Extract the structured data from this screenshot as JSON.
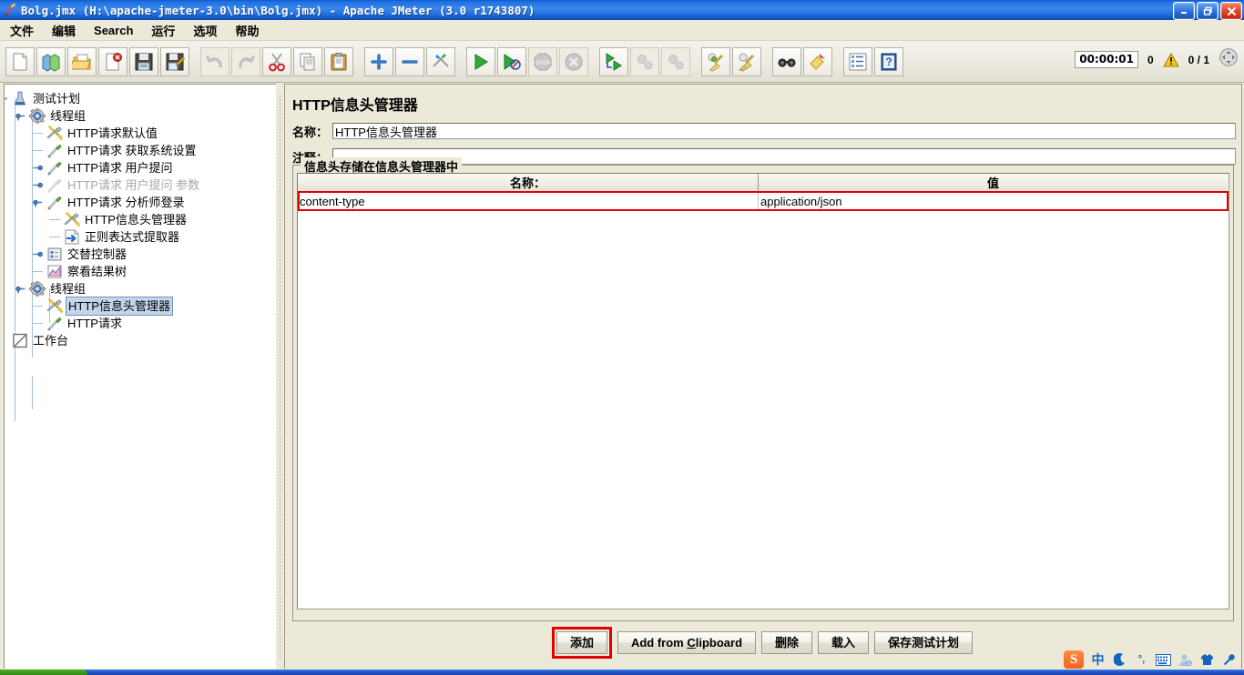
{
  "window": {
    "title": "Bolg.jmx (H:\\apache-jmeter-3.0\\bin\\Bolg.jmx) - Apache JMeter (3.0 r1743807)",
    "icon": "jmeter-feather-icon",
    "minimize_label": "_",
    "maximize_label": "❐",
    "close_label": "✕"
  },
  "menubar": {
    "items": [
      {
        "label": "文件",
        "name": "menu-file"
      },
      {
        "label": "编辑",
        "name": "menu-edit"
      },
      {
        "label": "Search",
        "name": "menu-search"
      },
      {
        "label": "运行",
        "name": "menu-run"
      },
      {
        "label": "选项",
        "name": "menu-options"
      },
      {
        "label": "帮助",
        "name": "menu-help"
      }
    ]
  },
  "toolbar": {
    "buttons": [
      {
        "name": "new-icon",
        "enabled": true
      },
      {
        "name": "templates-icon",
        "enabled": true
      },
      {
        "name": "open-icon",
        "enabled": true
      },
      {
        "name": "close-icon",
        "enabled": true
      },
      {
        "name": "save-icon",
        "enabled": true
      },
      {
        "name": "save-as-icon",
        "enabled": true
      },
      {
        "name": "undo-icon",
        "enabled": false
      },
      {
        "name": "redo-icon",
        "enabled": false
      },
      {
        "name": "cut-icon",
        "enabled": true
      },
      {
        "name": "copy-icon",
        "enabled": true
      },
      {
        "name": "paste-icon",
        "enabled": true
      },
      {
        "name": "expand-all-icon",
        "enabled": true
      },
      {
        "name": "collapse-all-icon",
        "enabled": true
      },
      {
        "name": "toggle-icon",
        "enabled": true
      },
      {
        "name": "start-icon",
        "enabled": true
      },
      {
        "name": "start-no-pauses-icon",
        "enabled": true
      },
      {
        "name": "stop-icon",
        "enabled": false
      },
      {
        "name": "shutdown-icon",
        "enabled": false
      },
      {
        "name": "remote-start-all-icon",
        "enabled": true
      },
      {
        "name": "remote-stop-all-icon",
        "enabled": false
      },
      {
        "name": "remote-shutdown-all-icon",
        "enabled": false
      },
      {
        "name": "clear-icon",
        "enabled": true
      },
      {
        "name": "clear-all-icon",
        "enabled": true
      },
      {
        "name": "search-icon",
        "enabled": true
      },
      {
        "name": "search-reset-icon",
        "enabled": true
      },
      {
        "name": "function-helper-icon",
        "enabled": true
      },
      {
        "name": "help-icon",
        "enabled": true
      }
    ],
    "status": {
      "timer": "00:00:01",
      "warning_count": "0",
      "warning_icon": "warning-triangle-icon",
      "threads_ratio": "0 / 1",
      "refresh_icon": "expand-arrows-icon"
    }
  },
  "tree": {
    "nodes": [
      {
        "label": "测试计划",
        "icon": "test-plan-icon",
        "depth": 0,
        "handle": "expanded",
        "state": "normal",
        "name": "tree-node-test-plan"
      },
      {
        "label": "线程组",
        "icon": "thread-group-icon",
        "depth": 1,
        "handle": "expanded",
        "state": "normal",
        "name": "tree-node-thread-group-1"
      },
      {
        "label": "HTTP请求默认值",
        "icon": "config-element-icon",
        "depth": 2,
        "handle": "none",
        "state": "normal",
        "name": "tree-node-http-defaults"
      },
      {
        "label": "HTTP请求 获取系统设置",
        "icon": "http-sampler-icon",
        "depth": 2,
        "handle": "none",
        "state": "normal",
        "name": "tree-node-http-get-system-settings"
      },
      {
        "label": "HTTP请求 用户提问",
        "icon": "http-sampler-icon",
        "depth": 2,
        "handle": "collapsed",
        "state": "normal",
        "name": "tree-node-http-user-question"
      },
      {
        "label": "HTTP请求 用户提问 参数",
        "icon": "http-sampler-disabled-icon",
        "depth": 2,
        "handle": "collapsed",
        "state": "disabled",
        "name": "tree-node-http-user-question-params"
      },
      {
        "label": "HTTP请求 分析师登录",
        "icon": "http-sampler-icon",
        "depth": 2,
        "handle": "expanded",
        "state": "normal",
        "name": "tree-node-http-analyst-login"
      },
      {
        "label": "HTTP信息头管理器",
        "icon": "config-element-icon",
        "depth": 3,
        "handle": "none",
        "state": "normal",
        "name": "tree-node-header-manager-1"
      },
      {
        "label": "正则表达式提取器",
        "icon": "regex-extractor-icon",
        "depth": 3,
        "handle": "none",
        "state": "normal",
        "name": "tree-node-regex-extractor"
      },
      {
        "label": "交替控制器",
        "icon": "interleave-controller-icon",
        "depth": 2,
        "handle": "collapsed",
        "state": "normal",
        "name": "tree-node-interleave-controller"
      },
      {
        "label": "察看结果树",
        "icon": "view-results-tree-icon",
        "depth": 2,
        "handle": "none",
        "state": "normal",
        "name": "tree-node-view-results-tree"
      },
      {
        "label": "线程组",
        "icon": "thread-group-icon",
        "depth": 1,
        "handle": "expanded",
        "state": "normal",
        "name": "tree-node-thread-group-2"
      },
      {
        "label": "HTTP信息头管理器",
        "icon": "config-element-icon",
        "depth": 2,
        "handle": "none",
        "state": "selected",
        "name": "tree-node-header-manager-2"
      },
      {
        "label": "HTTP请求",
        "icon": "http-sampler-icon",
        "depth": 2,
        "handle": "none",
        "state": "normal",
        "name": "tree-node-http-request"
      },
      {
        "label": "工作台",
        "icon": "workbench-icon",
        "depth": 0,
        "handle": "none",
        "state": "normal",
        "name": "tree-node-workbench"
      }
    ]
  },
  "panel": {
    "title": "HTTP信息头管理器",
    "name_label": "名称：",
    "name_value": "HTTP信息头管理器",
    "name_placeholder": "",
    "comment_label": "注释：",
    "comment_value": "",
    "comment_placeholder": "",
    "group_legend": "信息头存储在信息头管理器中",
    "table": {
      "columns": [
        "名称：",
        "值"
      ],
      "rows": [
        [
          "content-type",
          "application/json"
        ]
      ],
      "highlighted_row_index": 0,
      "highlight_color": "#e30000"
    },
    "buttons": [
      {
        "label": "添加",
        "name": "add-button",
        "highlighted": true
      },
      {
        "label": "Add from Clipboard",
        "name": "add-from-clipboard-button",
        "highlighted": false,
        "mnemonic": "C"
      },
      {
        "label": "删除",
        "name": "delete-button",
        "highlighted": false
      },
      {
        "label": "载入",
        "name": "load-button",
        "highlighted": false
      },
      {
        "label": "保存测试计划",
        "name": "save-test-plan-button",
        "highlighted": false
      }
    ]
  },
  "ime": {
    "logo": "S",
    "items": [
      {
        "glyph": "中",
        "name": "ime-chinese-mode-icon"
      },
      {
        "glyph": "☽",
        "name": "ime-moon-icon"
      },
      {
        "glyph": "°,",
        "name": "ime-punctuation-icon"
      },
      {
        "glyph": "⌨",
        "name": "ime-soft-keyboard-icon"
      },
      {
        "glyph": "👤",
        "name": "ime-user-icon"
      },
      {
        "glyph": "👕",
        "name": "ime-skin-icon"
      },
      {
        "glyph": "🔧",
        "name": "ime-settings-icon"
      }
    ]
  },
  "colors": {
    "title_blue": "#2a78e6",
    "panel_bg": "#ece9d8",
    "highlight_red": "#e30000",
    "tree_selection": "#c3d5ec"
  }
}
